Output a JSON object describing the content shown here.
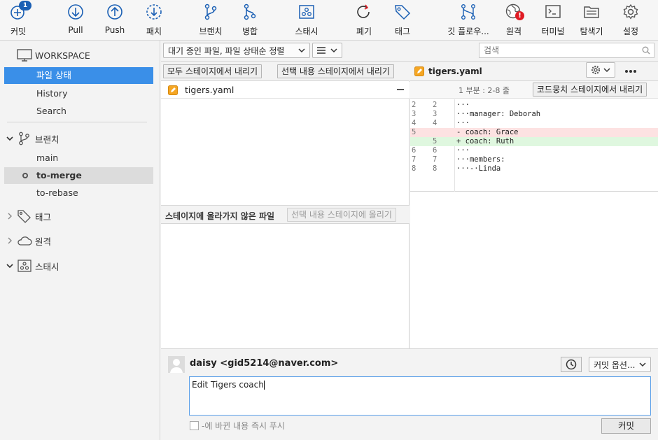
{
  "toolbar": {
    "commit": {
      "label": "커밋",
      "badge": "1"
    },
    "pull": {
      "label": "Pull"
    },
    "push": {
      "label": "Push"
    },
    "fetch": {
      "label": "패치"
    },
    "branch": {
      "label": "브랜치"
    },
    "merge": {
      "label": "병합"
    },
    "stash": {
      "label": "스태시"
    },
    "discard": {
      "label": "폐기"
    },
    "tag": {
      "label": "태그"
    },
    "gitflow": {
      "label": "깃 플로우..."
    },
    "remote": {
      "label": "원격",
      "alert": "!"
    },
    "terminal": {
      "label": "터미널"
    },
    "explorer": {
      "label": "탐색기"
    },
    "settings": {
      "label": "설정"
    }
  },
  "sidebar": {
    "workspace": {
      "label": "WORKSPACE"
    },
    "workspace_items": [
      "파일 상태",
      "History",
      "Search"
    ],
    "branches": {
      "label": "브랜치",
      "items": [
        "main",
        "to-merge",
        "to-rebase"
      ],
      "current": "to-merge"
    },
    "tags": {
      "label": "태그"
    },
    "remotes": {
      "label": "원격"
    },
    "stashes": {
      "label": "스태시"
    }
  },
  "filterbar": {
    "view_select": "대기 중인 파일, 파일 상태순 정렬",
    "list_mode_icon": "list-icon",
    "search_placeholder": "검색"
  },
  "staging": {
    "unstage_all": "모두 스테이지에서 내리기",
    "unstage_selected": "선택 내용 스테이지에서 내리기",
    "staged_files": [
      {
        "name": "tigers.yaml",
        "status": "modified"
      }
    ],
    "unstaged_header": "스테이지에 올라가지 않은 파일",
    "stage_selected": "선택 내용 스테이지에 올리기"
  },
  "diff": {
    "file": "tigers.yaml",
    "hunk": "1 부분 : 2-8 줄",
    "unstage_hunk": "코드뭉치 스테이지에서 내리기",
    "lines": [
      {
        "old": "2",
        "new": "2",
        "text": "···",
        "type": "ctx"
      },
      {
        "old": "3",
        "new": "3",
        "text": "···manager: Deborah",
        "type": "ctx"
      },
      {
        "old": "4",
        "new": "4",
        "text": "···",
        "type": "ctx"
      },
      {
        "old": "5",
        "new": "",
        "text": "- coach: Grace",
        "type": "del"
      },
      {
        "old": "",
        "new": "5",
        "text": "+ coach: Ruth",
        "type": "add"
      },
      {
        "old": "6",
        "new": "6",
        "text": "···",
        "type": "ctx"
      },
      {
        "old": "7",
        "new": "7",
        "text": "···members:",
        "type": "ctx"
      },
      {
        "old": "8",
        "new": "8",
        "text": "···-·Linda",
        "type": "ctx"
      }
    ]
  },
  "commit": {
    "author": "daisy <gid5214@naver.com>",
    "options": "커밋 옵션...",
    "message": "Edit Tigers coach",
    "push_immediately": "-에 바뀐 내용 즉시 푸시",
    "commit_button": "커밋"
  },
  "colors": {
    "accent": "#3a8fe8",
    "badge": "#1a5fb4",
    "alert": "#e01b24",
    "file_modified": "#f5a623",
    "diff_del": "#fde2e2",
    "diff_add": "#dff7df"
  }
}
